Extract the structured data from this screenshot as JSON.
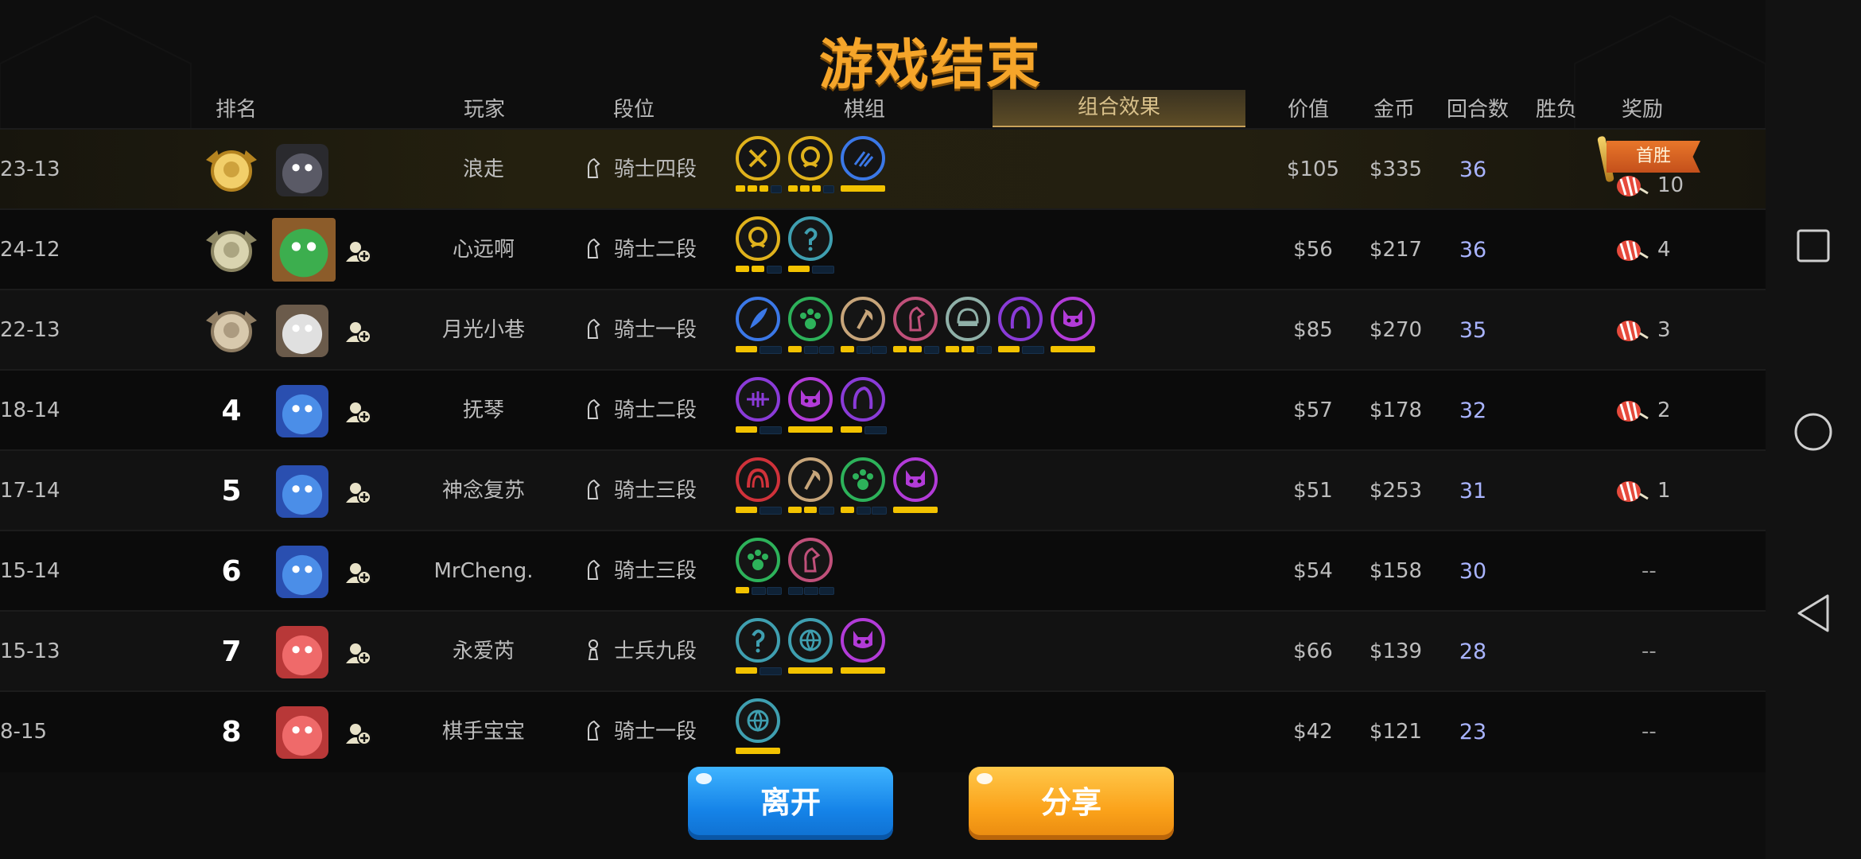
{
  "title": "游戏结束",
  "headers": {
    "rank": "排名",
    "player": "玩家",
    "tier": "段位",
    "synergy": "棋组",
    "combo_effect": "组合效果",
    "value": "价值",
    "gold": "金币",
    "rounds": "回合数",
    "winloss": "胜负",
    "reward": "奖励"
  },
  "colors": {
    "title": "#f5a52a",
    "rounds": "#a9b4ff",
    "bar_on": "#f2c200",
    "first_win_flag": "#e8762a",
    "leave_button": "#1583e8",
    "share_button": "#fba21a"
  },
  "rows": [
    {
      "rank": "1",
      "rank_display": "gold-medal-icon",
      "player": "浪走",
      "tier": "骑士四段",
      "tier_icon": "knight-icon",
      "value": "$105",
      "gold": "$335",
      "rounds": "36",
      "winloss": "23-13",
      "reward_label": "首胜",
      "reward_count": "10",
      "highlight": true,
      "synergies": [
        {
          "icon": "crossed-swords-icon",
          "color": "#e0b21c",
          "bars": [
            1,
            1,
            1,
            0
          ]
        },
        {
          "icon": "skull-icon",
          "color": "#e0b21c",
          "bars": [
            1,
            1,
            1,
            0
          ]
        },
        {
          "icon": "claw-icon",
          "color": "#3b78e7",
          "bars": [
            1
          ]
        }
      ]
    },
    {
      "rank": "2",
      "rank_display": "silver-medal-icon",
      "player": "心远啊",
      "tier": "骑士二段",
      "tier_icon": "knight-icon",
      "value": "$56",
      "gold": "$217",
      "rounds": "36",
      "winloss": "24-12",
      "reward_count": "4",
      "synergies": [
        {
          "icon": "skull-icon",
          "color": "#e0b21c",
          "bars": [
            1,
            1,
            0
          ]
        },
        {
          "icon": "question-mark-icon",
          "color": "#3f9fb0",
          "bars": [
            1,
            0
          ]
        }
      ]
    },
    {
      "rank": "3",
      "rank_display": "bronze-medal-icon",
      "player": "月光小巷",
      "tier": "骑士一段",
      "tier_icon": "knight-icon",
      "value": "$85",
      "gold": "$270",
      "rounds": "35",
      "winloss": "22-13",
      "reward_count": "3",
      "synergies": [
        {
          "icon": "feather-icon",
          "color": "#3b78e7",
          "bars": [
            1,
            0
          ]
        },
        {
          "icon": "paw-icon",
          "color": "#2db25a",
          "bars": [
            1,
            0,
            0
          ]
        },
        {
          "icon": "axe-icon",
          "color": "#c7a57a",
          "bars": [
            1,
            0,
            0
          ]
        },
        {
          "icon": "horse-icon",
          "color": "#c0507a",
          "bars": [
            1,
            1,
            0
          ]
        },
        {
          "icon": "helmet-icon",
          "color": "#8fb0a8",
          "bars": [
            1,
            1,
            0
          ]
        },
        {
          "icon": "hood-icon",
          "color": "#8a3bd8",
          "bars": [
            1,
            0
          ]
        },
        {
          "icon": "demon-icon",
          "color": "#b23bd8",
          "bars": [
            1
          ]
        }
      ]
    },
    {
      "rank": "4",
      "player": "抚琴",
      "tier": "骑士二段",
      "tier_icon": "knight-icon",
      "value": "$57",
      "gold": "$178",
      "rounds": "32",
      "winloss": "18-14",
      "reward_count": "2",
      "synergies": [
        {
          "icon": "fishbone-icon",
          "color": "#8a3bd8",
          "bars": [
            1,
            0
          ]
        },
        {
          "icon": "demon-icon",
          "color": "#b23bd8",
          "bars": [
            1
          ]
        },
        {
          "icon": "hood-icon",
          "color": "#8a3bd8",
          "bars": [
            1,
            0
          ]
        }
      ]
    },
    {
      "rank": "5",
      "player": "神念复苏",
      "tier": "骑士三段",
      "tier_icon": "knight-icon",
      "value": "$51",
      "gold": "$253",
      "rounds": "31",
      "winloss": "17-14",
      "reward_count": "1",
      "synergies": [
        {
          "icon": "arch-icon",
          "color": "#d0323a",
          "bars": [
            1,
            0
          ]
        },
        {
          "icon": "axe-icon",
          "color": "#c7a57a",
          "bars": [
            1,
            1,
            0
          ]
        },
        {
          "icon": "paw-icon",
          "color": "#2db25a",
          "bars": [
            1,
            0,
            0
          ]
        },
        {
          "icon": "demon-icon",
          "color": "#b23bd8",
          "bars": [
            1
          ]
        }
      ]
    },
    {
      "rank": "6",
      "player": "MrCheng.",
      "tier": "骑士三段",
      "tier_icon": "knight-icon",
      "value": "$54",
      "gold": "$158",
      "rounds": "30",
      "winloss": "15-14",
      "reward_count": "--",
      "synergies": [
        {
          "icon": "paw-icon",
          "color": "#2db25a",
          "bars": [
            1,
            0,
            0
          ]
        },
        {
          "icon": "horse-icon",
          "color": "#c0507a",
          "bars": [
            0,
            0,
            0
          ]
        }
      ]
    },
    {
      "rank": "7",
      "player": "永爱芮",
      "tier": "士兵九段",
      "tier_icon": "pawn-icon",
      "value": "$66",
      "gold": "$139",
      "rounds": "28",
      "winloss": "15-13",
      "reward_count": "--",
      "synergies": [
        {
          "icon": "question-mark-icon",
          "color": "#3f9fb0",
          "bars": [
            1,
            0
          ]
        },
        {
          "icon": "globe-icon",
          "color": "#3f9fb0",
          "bars": [
            1
          ]
        },
        {
          "icon": "demon-icon",
          "color": "#b23bd8",
          "bars": [
            1
          ]
        }
      ]
    },
    {
      "rank": "8",
      "player": "棋手宝宝",
      "tier": "骑士一段",
      "tier_icon": "knight-icon",
      "value": "$42",
      "gold": "$121",
      "rounds": "23",
      "winloss": "8-15",
      "reward_count": "--",
      "synergies": [
        {
          "icon": "globe-icon",
          "color": "#3f9fb0",
          "bars": [
            1
          ]
        }
      ]
    }
  ],
  "buttons": {
    "leave": "离开",
    "share": "分享"
  },
  "navbar": {
    "recents": "square-icon",
    "home": "circle-icon",
    "back": "triangle-back-icon"
  }
}
